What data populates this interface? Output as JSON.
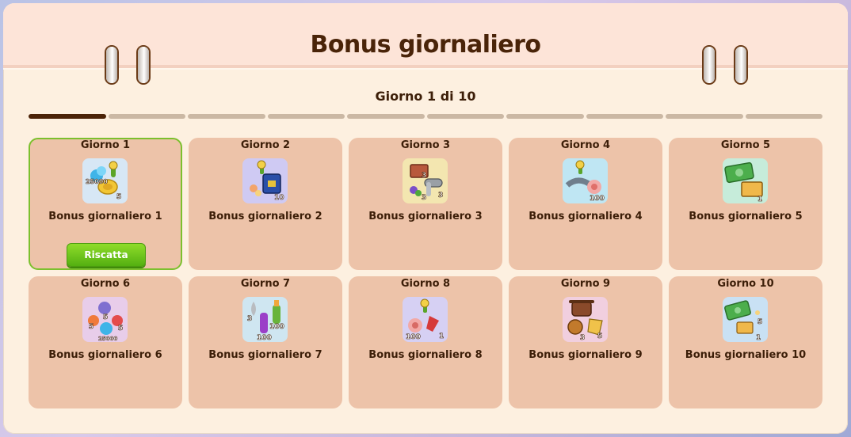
{
  "title": "Bonus giornaliero",
  "subtitle": "Giorno 1 di 10",
  "progress": {
    "current": 1,
    "total": 10
  },
  "colors": {
    "accent_green": "#6bc21d",
    "card_bg": "#edc3a9",
    "header_bg": "#fde4d8",
    "text_brown": "#3c1e08"
  },
  "cards": [
    {
      "day": "Giorno 1",
      "label": "Bonus giornaliero 1",
      "claim": "Riscatta",
      "icon": "gems-coins-key-icon",
      "badges": [
        "25000",
        "5"
      ]
    },
    {
      "day": "Giorno 2",
      "label": "Bonus giornaliero 2",
      "icon": "key-flowers-box-icon",
      "badges": [
        "10"
      ]
    },
    {
      "day": "Giorno 3",
      "label": "Bonus giornaliero 3",
      "icon": "bricks-pipes-icon",
      "badges": [
        "3",
        "3",
        "3"
      ]
    },
    {
      "day": "Giorno 4",
      "label": "Bonus giornaliero 4",
      "icon": "key-pipe-flower-icon",
      "badges": [
        "100"
      ]
    },
    {
      "day": "Giorno 5",
      "label": "Bonus giornaliero 5",
      "icon": "cash-ticket-icon",
      "badges": [
        "1"
      ]
    },
    {
      "day": "Giorno 6",
      "label": "Bonus giornaliero 6",
      "icon": "flowers-gems-icon",
      "badges": [
        "5",
        "5",
        "5",
        "25000"
      ]
    },
    {
      "day": "Giorno 7",
      "label": "Bonus giornaliero 7",
      "icon": "potions-drop-icon",
      "badges": [
        "3",
        "100",
        "100"
      ]
    },
    {
      "day": "Giorno 8",
      "label": "Bonus giornaliero 8",
      "icon": "key-shell-flower-icon",
      "badges": [
        "100",
        "1"
      ]
    },
    {
      "day": "Giorno 9",
      "label": "Bonus giornaliero 9",
      "icon": "pot-bread-map-icon",
      "badges": [
        "3",
        "5"
      ]
    },
    {
      "day": "Giorno 10",
      "label": "Bonus giornaliero 10",
      "icon": "cash-ticket-icon",
      "badges": [
        "5",
        "1"
      ]
    }
  ]
}
